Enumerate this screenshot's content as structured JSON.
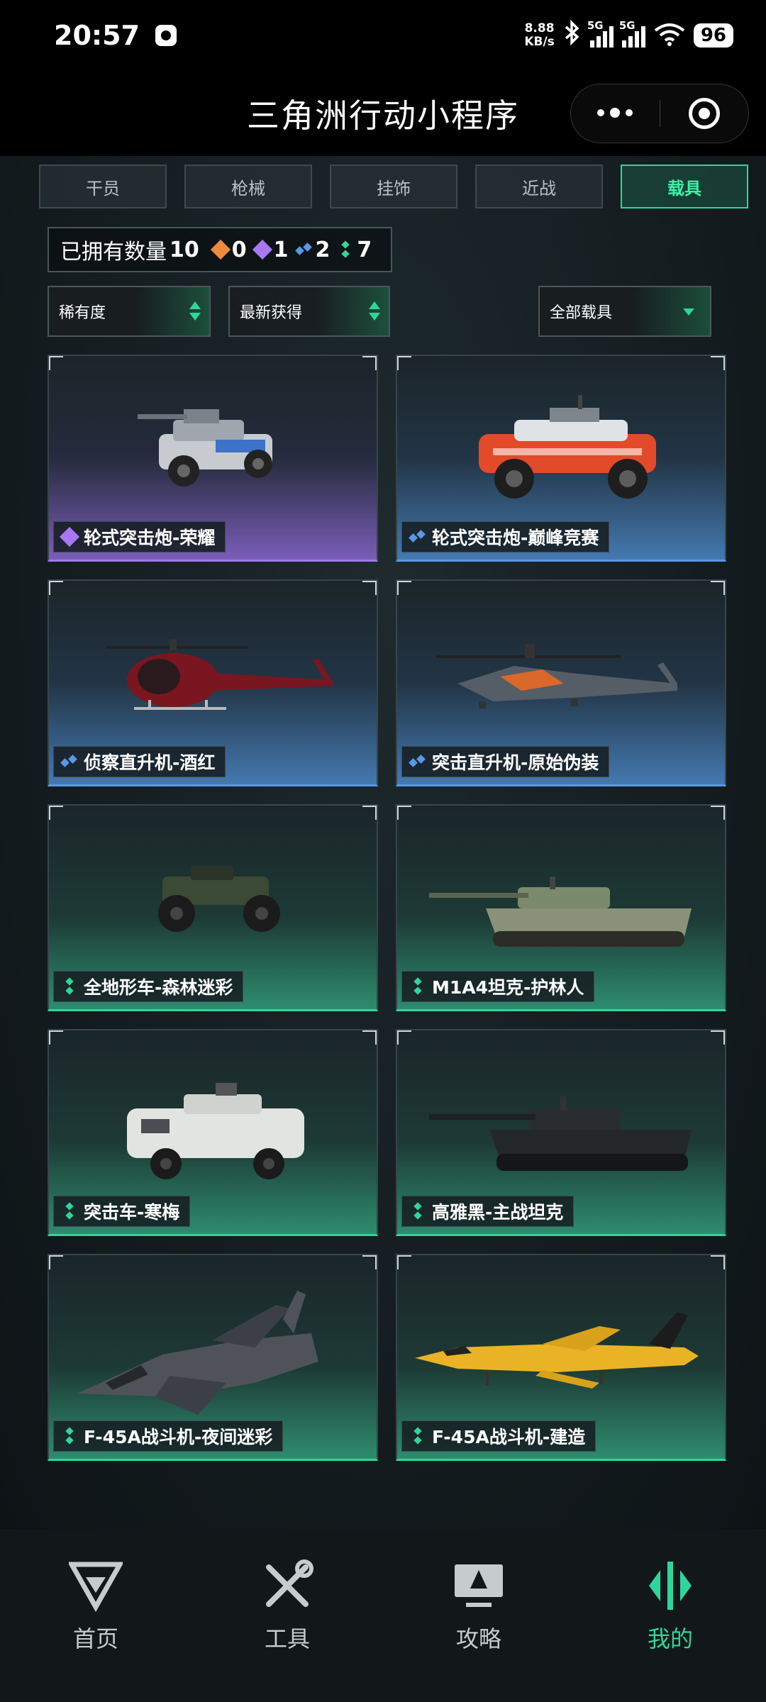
{
  "status_bar": {
    "time": "20:57",
    "net_speed_value": "8.88",
    "net_speed_unit": "KB/s",
    "sim1": "5G",
    "sim2": "5G",
    "battery": "96",
    "icons": [
      "app-notification-icon",
      "bluetooth-icon",
      "signal-icon",
      "wifi-icon",
      "battery-icon"
    ]
  },
  "title_bar": {
    "title": "三角洲行动小程序",
    "more_icon": "more-dots-icon",
    "close_icon": "target-close-icon"
  },
  "tabs": [
    {
      "label": "干员",
      "active": false
    },
    {
      "label": "枪械",
      "active": false
    },
    {
      "label": "挂饰",
      "active": false
    },
    {
      "label": "近战",
      "active": false
    },
    {
      "label": "载具",
      "active": true
    }
  ],
  "counts": {
    "label": "已拥有数量",
    "total": "10",
    "orange": "0",
    "purple": "1",
    "blue": "2",
    "green": "7"
  },
  "filters": {
    "rarity": "稀有度",
    "sort": "最新获得",
    "category": "全部载具"
  },
  "vehicles": [
    {
      "name": "轮式突击炮-荣耀",
      "rarity": "purple",
      "kind": "armored-car"
    },
    {
      "name": "轮式突击炮-巅峰竞赛",
      "rarity": "blue",
      "kind": "armored-car-red"
    },
    {
      "name": "侦察直升机-酒红",
      "rarity": "blue",
      "kind": "helicopter-small"
    },
    {
      "name": "突击直升机-原始伪装",
      "rarity": "blue",
      "kind": "helicopter-attack"
    },
    {
      "name": "全地形车-森林迷彩",
      "rarity": "green",
      "kind": "atv"
    },
    {
      "name": "M1A4坦克-护林人",
      "rarity": "green",
      "kind": "tank-camo"
    },
    {
      "name": "突击车-寒梅",
      "rarity": "green",
      "kind": "apc"
    },
    {
      "name": "高雅黑-主战坦克",
      "rarity": "green",
      "kind": "tank-black"
    },
    {
      "name": "F-45A战斗机-夜间迷彩",
      "rarity": "green",
      "kind": "jet-camo"
    },
    {
      "name": "F-45A战斗机-建造",
      "rarity": "green",
      "kind": "jet-yellow"
    }
  ],
  "bottom_nav": [
    {
      "label": "首页",
      "icon": "home-logo-icon",
      "active": false
    },
    {
      "label": "工具",
      "icon": "tools-icon",
      "active": false
    },
    {
      "label": "攻略",
      "icon": "guide-screen-icon",
      "active": false
    },
    {
      "label": "我的",
      "icon": "profile-logo-icon",
      "active": true
    }
  ],
  "colors": {
    "accent": "#2fd69a",
    "purple": "#a07be8",
    "blue": "#5b97e6",
    "orange": "#f08a3c"
  }
}
